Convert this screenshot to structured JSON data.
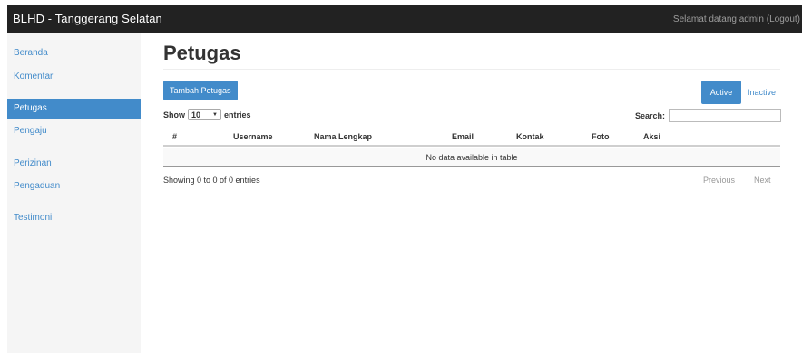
{
  "navbar": {
    "brand": "BLHD - Tanggerang Selatan",
    "welcome": "Selamat datang admin (Logout)"
  },
  "sidebar": {
    "items": [
      {
        "label": "Beranda"
      },
      {
        "label": "Komentar"
      },
      {
        "label": "Petugas",
        "active": true
      },
      {
        "label": "Pengaju"
      },
      {
        "label": "Perizinan"
      },
      {
        "label": "Pengaduan"
      },
      {
        "label": "Testimoni"
      }
    ]
  },
  "page": {
    "title": "Petugas"
  },
  "toolbar": {
    "add_label": "Tambah Petugas",
    "active_label": "Active",
    "inactive_label": "Inactive"
  },
  "table_controls": {
    "show_label": "Show",
    "length_value": "10",
    "entries_label": "entries",
    "search_label": "Search:"
  },
  "table": {
    "columns": [
      "#",
      "Username",
      "Nama Lengkap",
      "Email",
      "Kontak",
      "Foto",
      "Aksi"
    ],
    "empty_text": "No data available in table"
  },
  "footer": {
    "info": "Showing 0 to 0 of 0 entries",
    "previous": "Previous",
    "next": "Next"
  },
  "colors": {
    "accent": "#428bca",
    "navbar_bg": "#222222",
    "sidebar_bg": "#f5f5f5"
  }
}
